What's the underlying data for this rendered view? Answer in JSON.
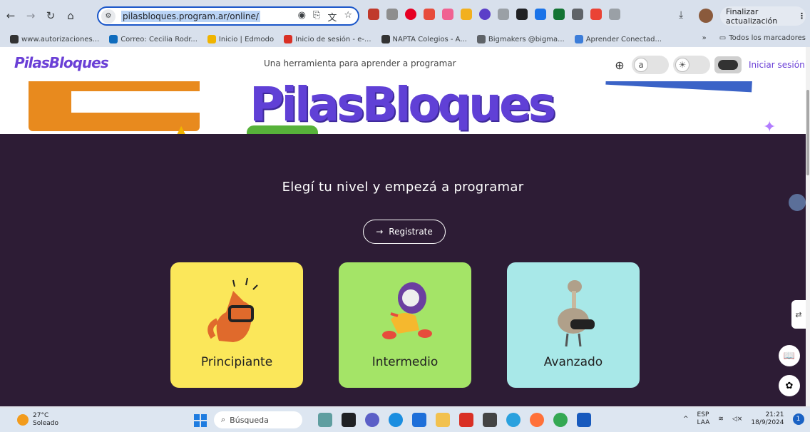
{
  "browser": {
    "url": "pilasbloques.program.ar/online/",
    "update_button": "Finalizar actualización",
    "bookmarks": [
      {
        "label": "www.autorizaciones...",
        "color": "#333333"
      },
      {
        "label": "Correo: Cecilia Rodr...",
        "color": "#0f6cbd"
      },
      {
        "label": "Inicio | Edmodo",
        "color": "#f0b400"
      },
      {
        "label": "Inicio de sesión - e-...",
        "color": "#d93025"
      },
      {
        "label": "NAPTA Colegios - A...",
        "color": "#333333"
      },
      {
        "label": "Bigmakers @bigma...",
        "color": "#5f6368"
      },
      {
        "label": "Aprender Conectad...",
        "color": "#3c7dd9"
      }
    ],
    "bookmarks_overflow": "»",
    "all_bookmarks": "Todos los marcadores"
  },
  "site": {
    "logo": "PilasBloques",
    "tagline": "Una herramienta para aprender a programar",
    "font_toggle": "a",
    "login": "Iniciar sesión",
    "hero_title": "PilasBloques",
    "headline": "Elegí tu nivel y empezá a programar",
    "register": "Registrate",
    "levels": [
      {
        "label": "Principiante",
        "color": "#fbe75a"
      },
      {
        "label": "Intermedio",
        "color": "#a4e467"
      },
      {
        "label": "Avanzado",
        "color": "#a8e8e8"
      }
    ],
    "brand_color": "#6a3fd6",
    "background_color": "#2d1c35"
  },
  "taskbar": {
    "temperature": "27°C",
    "weather": "Soleado",
    "search": "Búsqueda",
    "lang_top": "ESP",
    "lang_bottom": "LAA",
    "time": "21:21",
    "date": "18/9/2024",
    "notifications": "1"
  }
}
